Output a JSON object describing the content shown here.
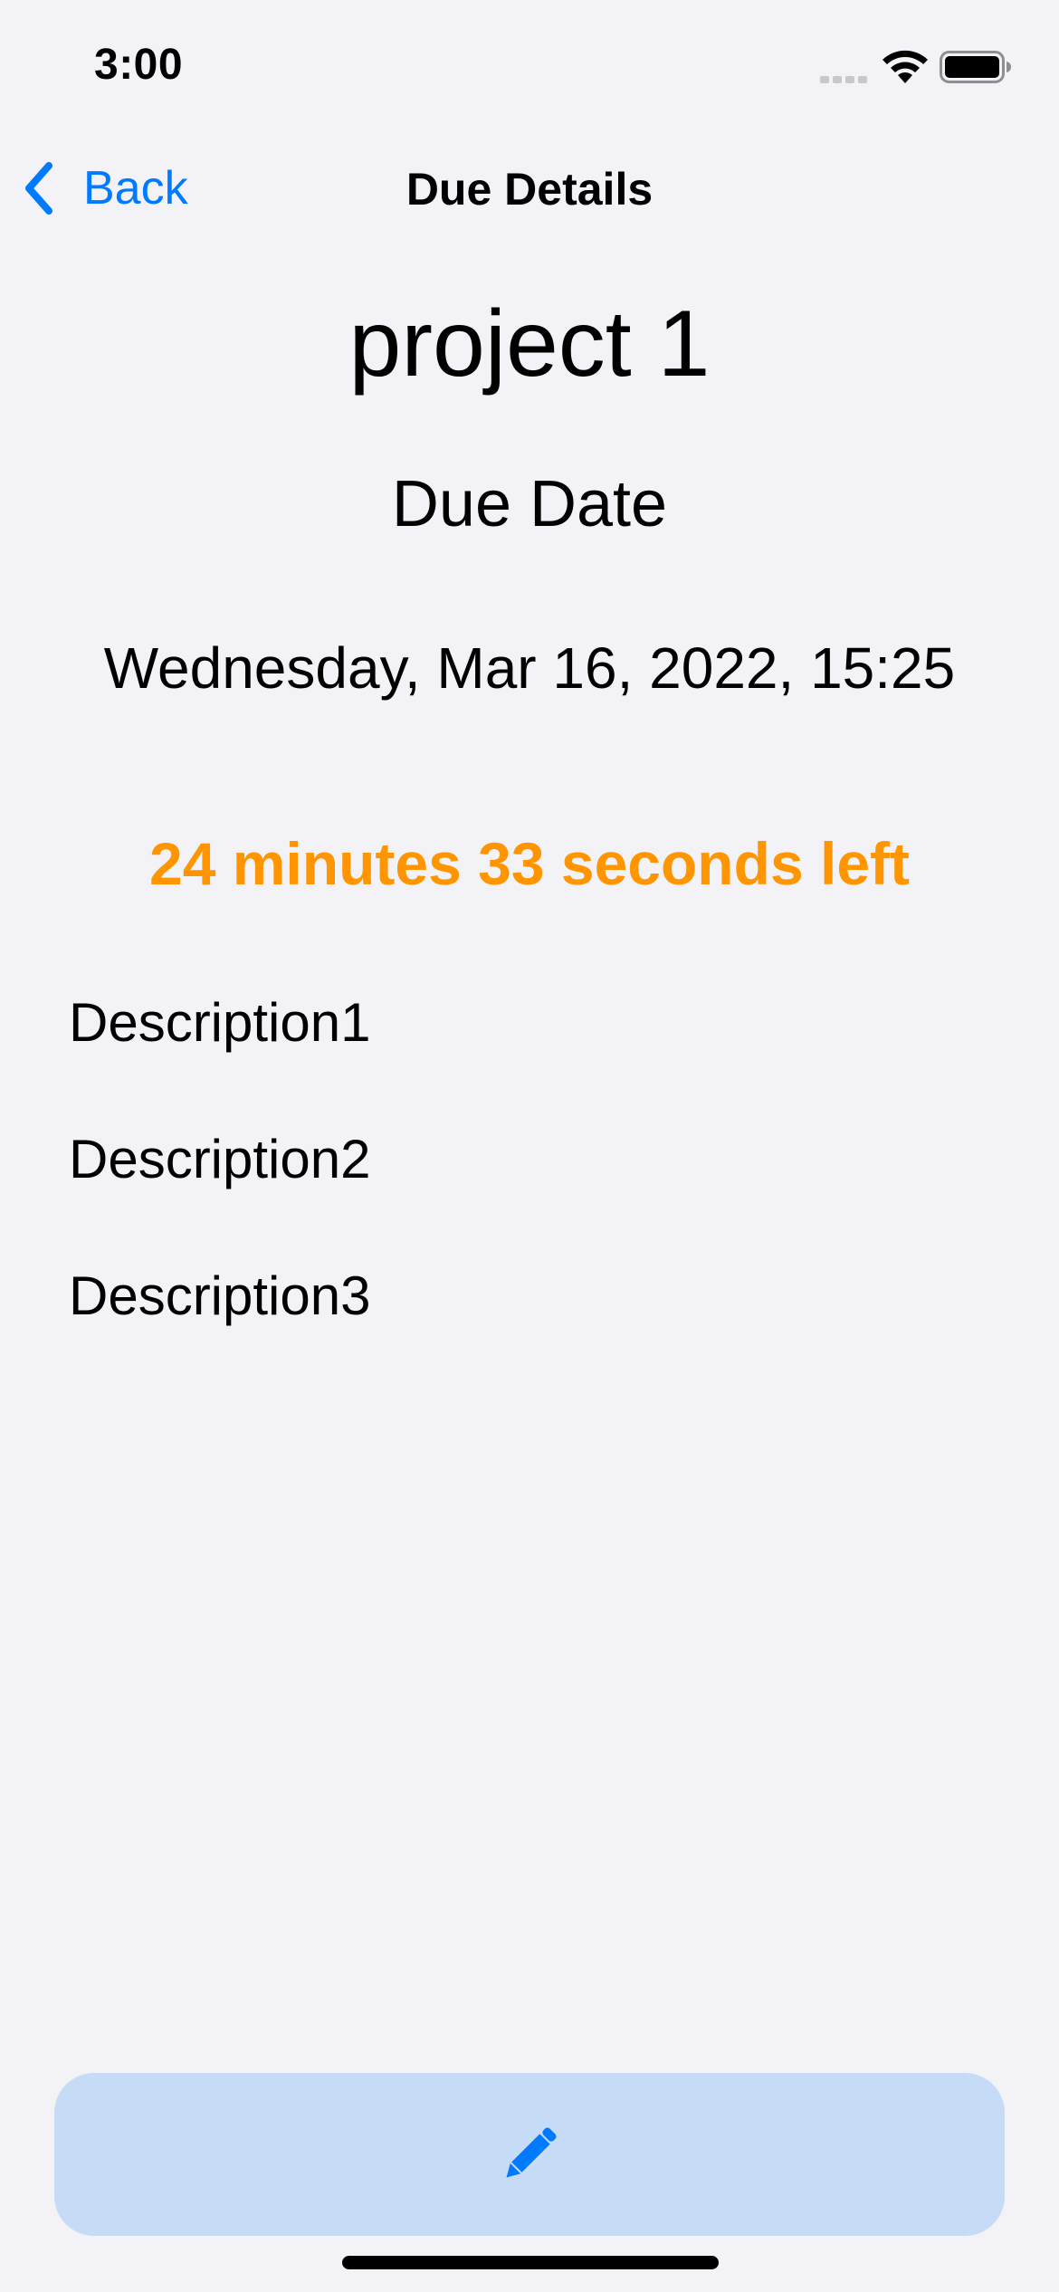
{
  "status_bar": {
    "time": "3:00"
  },
  "nav": {
    "back_label": "Back",
    "title": "Due Details"
  },
  "detail": {
    "project_name": "project 1",
    "due_date_label": "Due Date",
    "due_date_value": "Wednesday, Mar 16, 2022, 15:25",
    "time_left": "24 minutes 33 seconds left",
    "descriptions": [
      "Description1",
      "Description2",
      "Description3"
    ]
  },
  "colors": {
    "accent": "#007aff",
    "warning": "#ff9500",
    "background": "#f2f2f7",
    "button_fill": "#c5dbf6"
  },
  "icons": {
    "back": "chevron-left-icon",
    "edit": "pencil-icon",
    "signal": "cellular-signal-icon",
    "wifi": "wifi-icon",
    "battery": "battery-icon"
  }
}
